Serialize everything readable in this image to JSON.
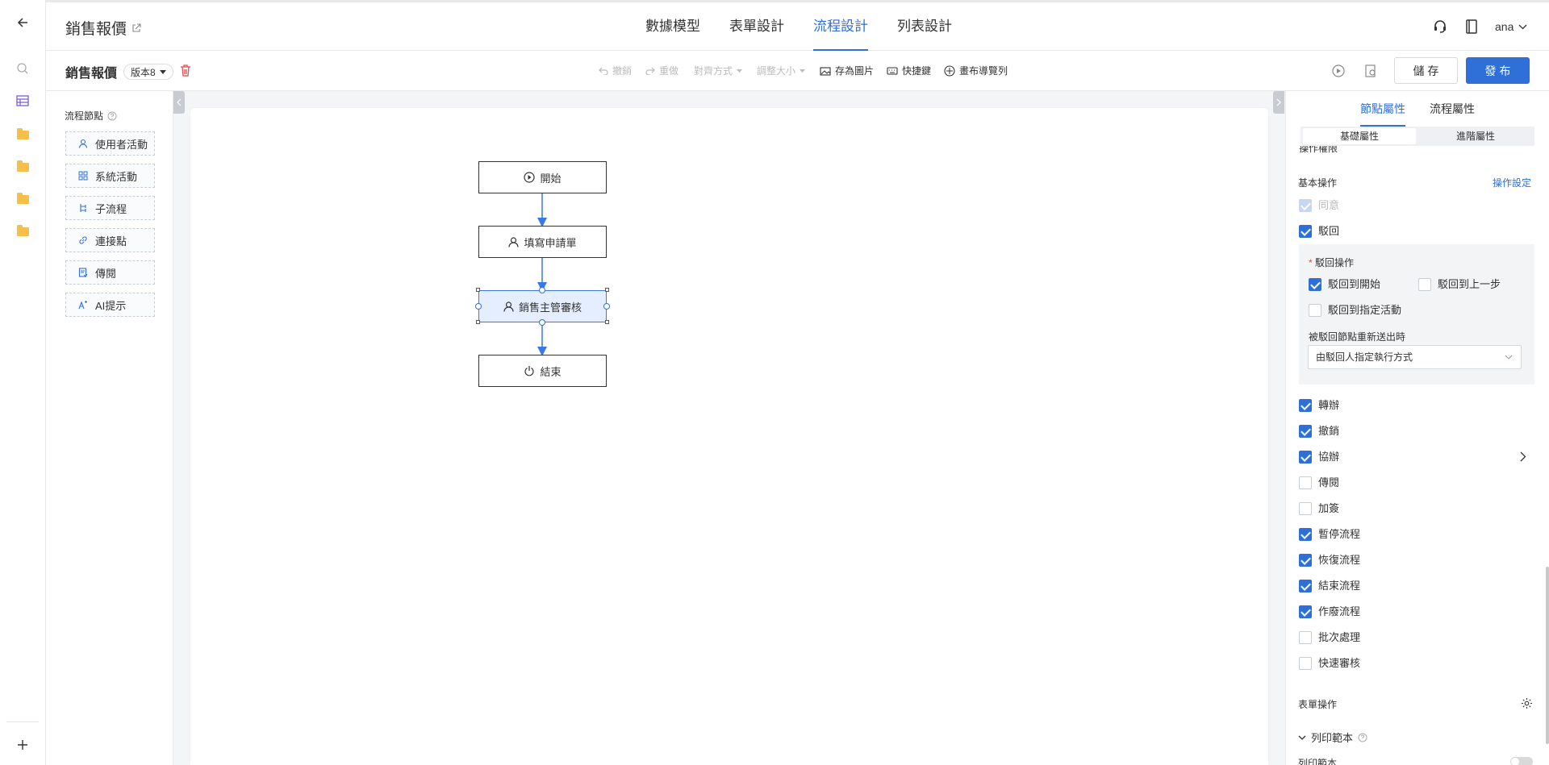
{
  "app": {
    "title": "銷售報價",
    "tabs": [
      "數據模型",
      "表單設計",
      "流程設計",
      "列表設計"
    ],
    "active_tab": "流程設計",
    "user": "ana"
  },
  "toolbar": {
    "form_name": "銷售報價",
    "version": "版本8",
    "undo": "撤銷",
    "redo": "重做",
    "align": "對齊方式",
    "resize": "調整大小",
    "save_image": "存為圖片",
    "shortcuts": "快捷鍵",
    "canvas_nav": "畫布導覽列",
    "save": "儲 存",
    "publish": "發 布"
  },
  "node_panel": {
    "title": "流程節點",
    "items": [
      {
        "label": "使用者活動",
        "icon": "user-icon"
      },
      {
        "label": "系統活動",
        "icon": "grid-icon"
      },
      {
        "label": "子流程",
        "icon": "subflow-icon"
      },
      {
        "label": "連接點",
        "icon": "link-icon"
      },
      {
        "label": "傳閱",
        "icon": "circulate-icon"
      },
      {
        "label": "AI提示",
        "icon": "ai-icon"
      }
    ]
  },
  "flow": {
    "nodes": [
      {
        "label": "開始",
        "icon": "play-icon"
      },
      {
        "label": "填寫申請單",
        "icon": "user-icon"
      },
      {
        "label": "銷售主管審核",
        "icon": "user-icon",
        "selected": true
      },
      {
        "label": "結束",
        "icon": "power-icon"
      }
    ]
  },
  "right_panel": {
    "tabs": [
      "節點屬性",
      "流程屬性"
    ],
    "subtabs": [
      "基礎屬性",
      "進階屬性"
    ],
    "section_partial": "操作權限",
    "basic_ops_label": "基本操作",
    "ops_settings": "操作設定",
    "agree": "同意",
    "reject": "駁回",
    "reject_op_label": "駁回操作",
    "reject_to_start": "駁回到開始",
    "reject_to_prev": "駁回到上一步",
    "reject_to_specified": "駁回到指定活動",
    "resubmit_label": "被駁回節點重新送出時",
    "resubmit_value": "由駁回人指定執行方式",
    "ops": [
      {
        "label": "轉辦",
        "checked": true
      },
      {
        "label": "撤銷",
        "checked": true
      },
      {
        "label": "協辦",
        "checked": true
      },
      {
        "label": "傳閱",
        "checked": false
      },
      {
        "label": "加簽",
        "checked": false
      },
      {
        "label": "暫停流程",
        "checked": true
      },
      {
        "label": "恢復流程",
        "checked": true
      },
      {
        "label": "結束流程",
        "checked": true
      },
      {
        "label": "作廢流程",
        "checked": true
      },
      {
        "label": "批次處理",
        "checked": false
      },
      {
        "label": "快速審核",
        "checked": false
      }
    ],
    "form_ops_label": "表單操作",
    "print_template_section": "列印範本",
    "print_template_label": "列印範本"
  },
  "colors": {
    "accent": "#2f6fd8",
    "delete": "#e04a4a",
    "folder": "#f5c04a"
  }
}
